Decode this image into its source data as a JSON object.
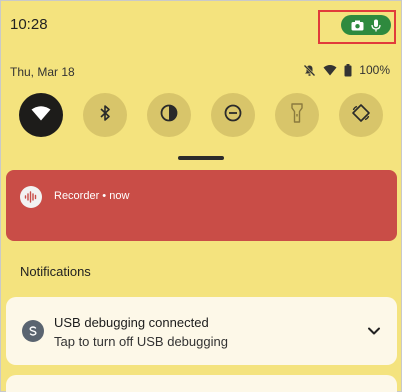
{
  "statusbar": {
    "time": "10:28",
    "privacy_indicators": [
      "camera-icon",
      "mic-icon"
    ],
    "privacy_chip_color": "#2e8a3e"
  },
  "header": {
    "date": "Thu, Mar 18",
    "battery": "100%",
    "status_icons": [
      "mute-icon",
      "wifi-icon",
      "battery-icon"
    ]
  },
  "quick_settings": {
    "tiles": [
      {
        "icon": "wifi-icon",
        "active": true
      },
      {
        "icon": "bluetooth-icon",
        "active": false
      },
      {
        "icon": "dark-theme-icon",
        "active": false
      },
      {
        "icon": "do-not-disturb-icon",
        "active": false
      },
      {
        "icon": "flashlight-icon",
        "active": false
      },
      {
        "icon": "auto-rotate-icon",
        "active": false
      }
    ]
  },
  "recorder": {
    "text": "Recorder • now",
    "color": "#c94d47"
  },
  "notifications": {
    "section_title": "Notifications",
    "usb": {
      "title": "USB debugging connected",
      "subtitle": "Tap to turn off USB debugging"
    }
  },
  "colors": {
    "background": "#f4e37e",
    "tile_inactive": "#d8c56a",
    "tile_active": "#1d1c1a",
    "card": "#fdf8e8"
  }
}
